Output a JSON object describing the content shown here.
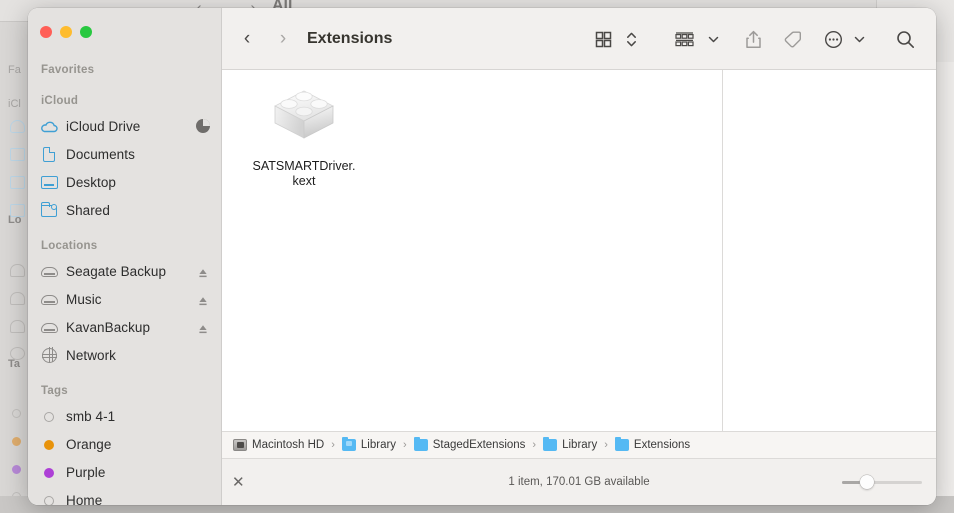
{
  "window": {
    "title": "Extensions",
    "traffic_lights": [
      {
        "name": "close",
        "color": "#ff5f57"
      },
      {
        "name": "minimize",
        "color": "#febc2e"
      },
      {
        "name": "zoom",
        "color": "#28c840"
      }
    ]
  },
  "background": {
    "all_label": "All",
    "nav_arrows": "‹  ›"
  },
  "toolbar": {
    "back_glyph": "‹",
    "forward_glyph": "›",
    "title": "Extensions",
    "buttons": [
      {
        "name": "view-grid-icon",
        "label": "Icon View"
      },
      {
        "name": "view-sort-chevrons-icon",
        "label": "Sort Order"
      },
      {
        "name": "group-by-icon",
        "label": "Group Items"
      },
      {
        "name": "group-by-chevron-down-icon",
        "label": "Group Options"
      },
      {
        "name": "share-icon",
        "label": "Share"
      },
      {
        "name": "tag-icon",
        "label": "Tags"
      },
      {
        "name": "more-options-icon",
        "label": "More"
      },
      {
        "name": "more-chevron-down-icon",
        "label": "More Options"
      },
      {
        "name": "search-icon",
        "label": "Search"
      }
    ]
  },
  "sidebar": {
    "sections": [
      {
        "heading": "Favorites",
        "items": []
      },
      {
        "heading": "iCloud",
        "items": [
          {
            "label": "iCloud Drive",
            "icon": "cloud-icon",
            "badge": "sync-progress"
          },
          {
            "label": "Documents",
            "icon": "document-icon",
            "badge": ""
          },
          {
            "label": "Desktop",
            "icon": "desktop-icon",
            "badge": ""
          },
          {
            "label": "Shared",
            "icon": "shared-folder-icon",
            "badge": ""
          }
        ]
      },
      {
        "heading": "Locations",
        "items": [
          {
            "label": "Seagate Backup",
            "icon": "drive-icon",
            "badge": "eject"
          },
          {
            "label": "Music",
            "icon": "drive-icon",
            "badge": "eject"
          },
          {
            "label": "KavanBackup",
            "icon": "drive-icon",
            "badge": "eject"
          },
          {
            "label": "Network",
            "icon": "globe-icon",
            "badge": ""
          }
        ]
      },
      {
        "heading": "Tags",
        "items": [
          {
            "label": "smb 4-1",
            "icon": "tag-dot-icon",
            "color": "transparent"
          },
          {
            "label": "Orange",
            "icon": "tag-dot-icon",
            "color": "#e8930b"
          },
          {
            "label": "Purple",
            "icon": "tag-dot-icon",
            "color": "#ad3fd6"
          },
          {
            "label": "Home",
            "icon": "tag-dot-icon",
            "color": "transparent"
          }
        ]
      }
    ]
  },
  "content": {
    "files": [
      {
        "name": "SATSMARTDriver.\nkext",
        "icon": "kernel-extension-icon"
      }
    ]
  },
  "pathbar": {
    "crumbs": [
      {
        "label": "Macintosh HD",
        "icon": "hard-drive-icon"
      },
      {
        "label": "Library",
        "icon": "folder-icon"
      },
      {
        "label": "StagedExtensions",
        "icon": "folder-icon"
      },
      {
        "label": "Library",
        "icon": "folder-icon-tinted"
      },
      {
        "label": "Extensions",
        "icon": "folder-icon"
      }
    ],
    "separator": "›"
  },
  "statusbar": {
    "close_glyph": "✕",
    "status": "1 item, 170.01 GB available",
    "zoom_value": 25
  }
}
